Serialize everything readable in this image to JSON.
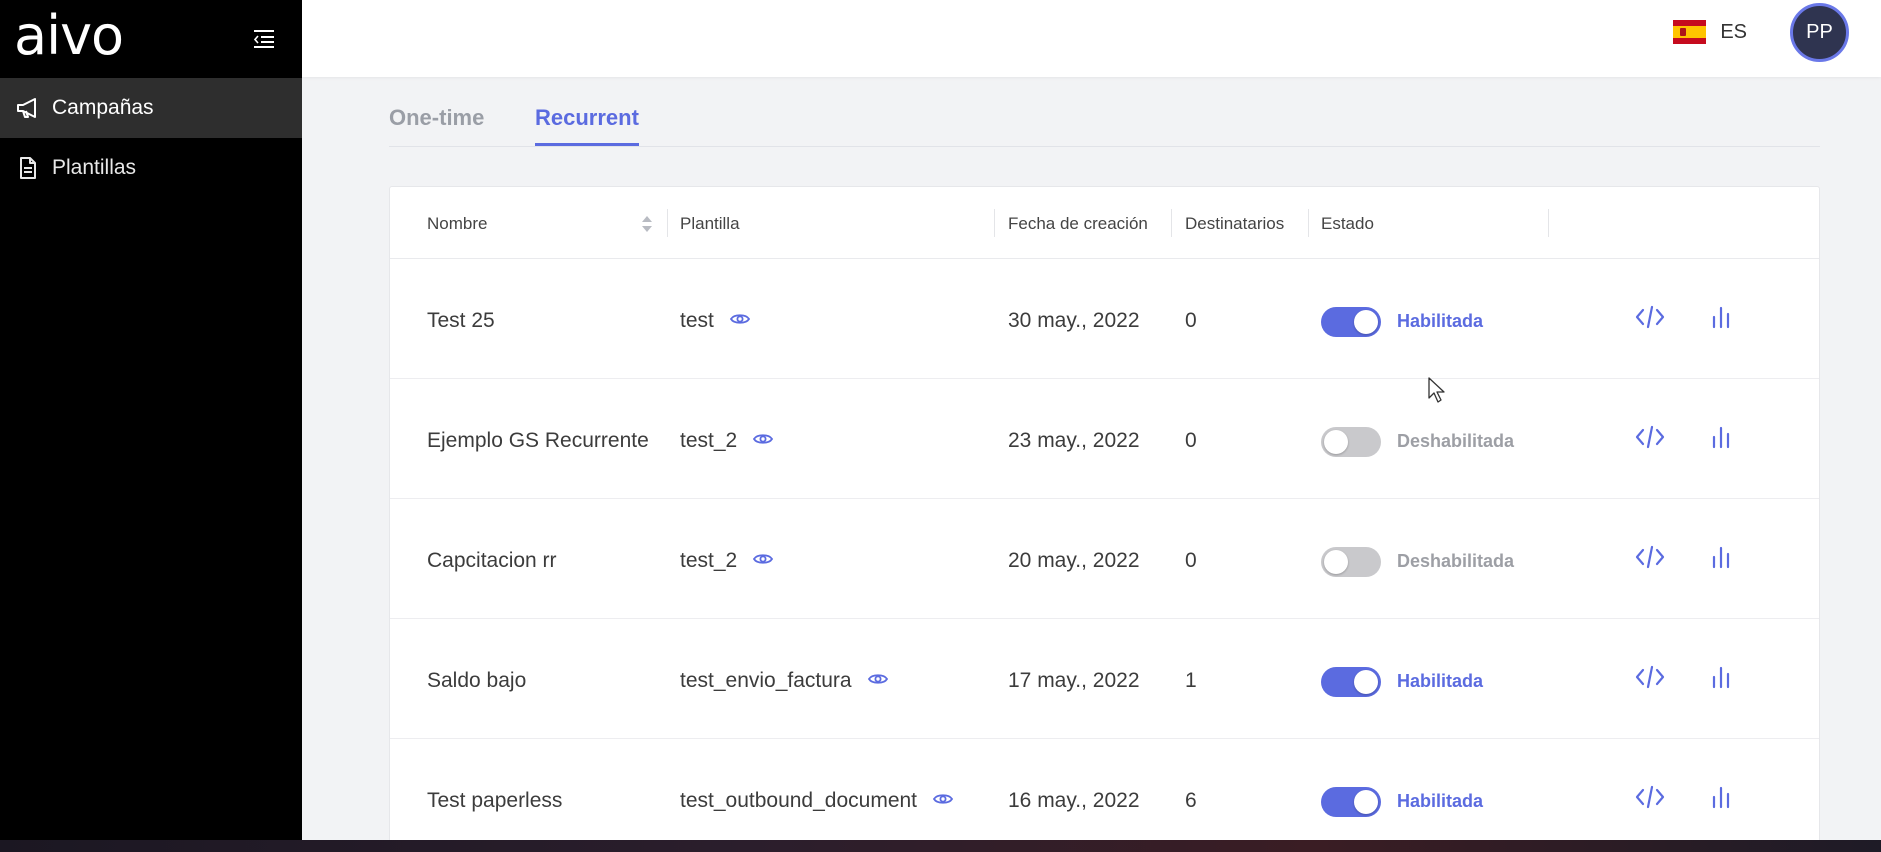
{
  "brand": {
    "logo_text": "aivo"
  },
  "sidebar": {
    "items": [
      {
        "label": "Campañas",
        "icon": "megaphone-icon",
        "active": true
      },
      {
        "label": "Plantillas",
        "icon": "document-icon",
        "active": false
      }
    ]
  },
  "header": {
    "language": "ES",
    "avatar_initials": "PP"
  },
  "tabs": [
    {
      "label": "One-time",
      "active": false
    },
    {
      "label": "Recurrent",
      "active": true
    }
  ],
  "table": {
    "columns": [
      "Nombre",
      "Plantilla",
      "Fecha de creación",
      "Destinatarios",
      "Estado"
    ],
    "rows": [
      {
        "name": "Test 25",
        "template": "test",
        "created": "30 may., 2022",
        "recipients": "0",
        "enabled": true,
        "status": "Habilitada"
      },
      {
        "name": "Ejemplo GS Recurrente",
        "template": "test_2",
        "created": "23 may., 2022",
        "recipients": "0",
        "enabled": false,
        "status": "Deshabilitada"
      },
      {
        "name": "Capcitacion rr",
        "template": "test_2",
        "created": "20 may., 2022",
        "recipients": "0",
        "enabled": false,
        "status": "Deshabilitada"
      },
      {
        "name": "Saldo bajo",
        "template": "test_envio_factura",
        "created": "17 may., 2022",
        "recipients": "1",
        "enabled": true,
        "status": "Habilitada"
      },
      {
        "name": "Test paperless",
        "template": "test_outbound_document",
        "created": "16 may., 2022",
        "recipients": "6",
        "enabled": true,
        "status": "Habilitada"
      }
    ]
  },
  "colors": {
    "accent": "#5b6be0",
    "sidebar_bg": "#000000",
    "sidebar_active": "#2e2e2e",
    "toggle_off": "#c9c9cc"
  }
}
